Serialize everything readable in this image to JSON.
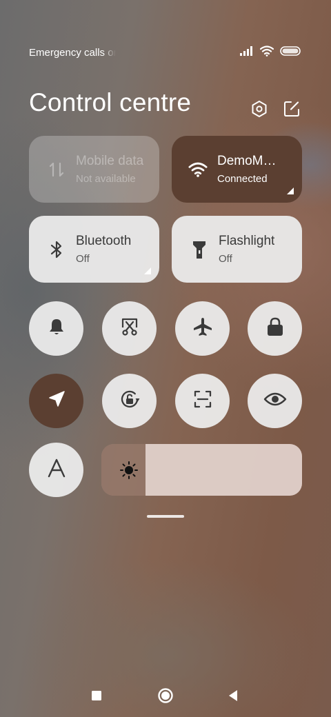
{
  "status_bar": {
    "carrier_text": "Emergency calls only",
    "icons": [
      "signal-icon",
      "wifi-icon",
      "battery-icon"
    ]
  },
  "header": {
    "title": "Control centre",
    "icons": [
      "settings-icon",
      "edit-icon"
    ]
  },
  "tiles": {
    "mobile_data": {
      "label": "Mobile data",
      "status": "Not available",
      "icon": "mobile-data-icon",
      "state": "disabled"
    },
    "wifi": {
      "label": "DemoMode",
      "status": "Connected",
      "icon": "wifi-icon",
      "state": "on"
    },
    "bluetooth": {
      "label": "Bluetooth",
      "status": "Off",
      "icon": "bluetooth-icon",
      "state": "off"
    },
    "flashlight": {
      "label": "Flashlight",
      "status": "Off",
      "icon": "flashlight-icon",
      "state": "off"
    }
  },
  "toggles": [
    {
      "icon": "bell-icon",
      "state": "off"
    },
    {
      "icon": "screenshot-icon",
      "state": "off"
    },
    {
      "icon": "airplane-icon",
      "state": "off"
    },
    {
      "icon": "lock-icon",
      "state": "off"
    },
    {
      "icon": "location-icon",
      "state": "on"
    },
    {
      "icon": "rotation-lock-icon",
      "state": "off"
    },
    {
      "icon": "scanner-icon",
      "state": "off"
    },
    {
      "icon": "eye-icon",
      "state": "off"
    },
    {
      "icon": "font-icon",
      "state": "off"
    }
  ],
  "brightness": {
    "icon": "sun-icon",
    "level_fraction": 0.22
  },
  "nav_bar": {
    "icons": [
      "recents-icon",
      "home-icon",
      "back-icon"
    ]
  },
  "colors": {
    "accent": "#5b3f31",
    "tile_bg": "#ececec",
    "icon": "#3a3a3a"
  }
}
